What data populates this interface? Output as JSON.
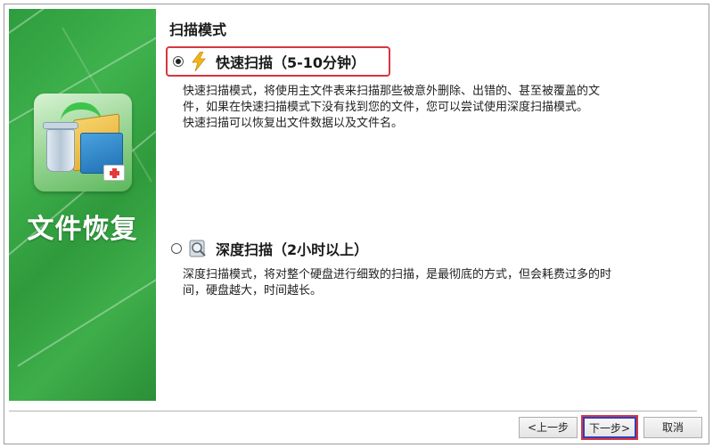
{
  "banner": {
    "title": "文件恢复",
    "icon": "file-recovery-app-icon"
  },
  "scan_mode": {
    "section_title": "扫描模式",
    "options": [
      {
        "id": "quick",
        "label": "快速扫描（5-10分钟）",
        "selected": true,
        "icon": "lightning-icon",
        "description": [
          "快速扫描模式，将使用主文件表来扫描那些被意外删除、出错的、甚至被覆盖的文",
          "件，如果在快速扫描模式下没有找到您的文件，您可以尝试使用深度扫描模式。",
          "快速扫描可以恢复出文件数据以及文件名。"
        ]
      },
      {
        "id": "deep",
        "label": "深度扫描（2小时以上）",
        "selected": false,
        "icon": "magnifier-disk-icon",
        "description": [
          "深度扫描模式，将对整个硬盘进行细致的扫描，是最彻底的方式，但会耗费过多的时",
          "间，硬盘越大，时间越长。"
        ]
      }
    ]
  },
  "buttons": {
    "prev": "<上一步",
    "next": "下一步>",
    "cancel": "取消"
  },
  "colors": {
    "banner_green": "#3aa847",
    "highlight_red": "#d9363e",
    "focus_blue": "#2b3fbf"
  }
}
